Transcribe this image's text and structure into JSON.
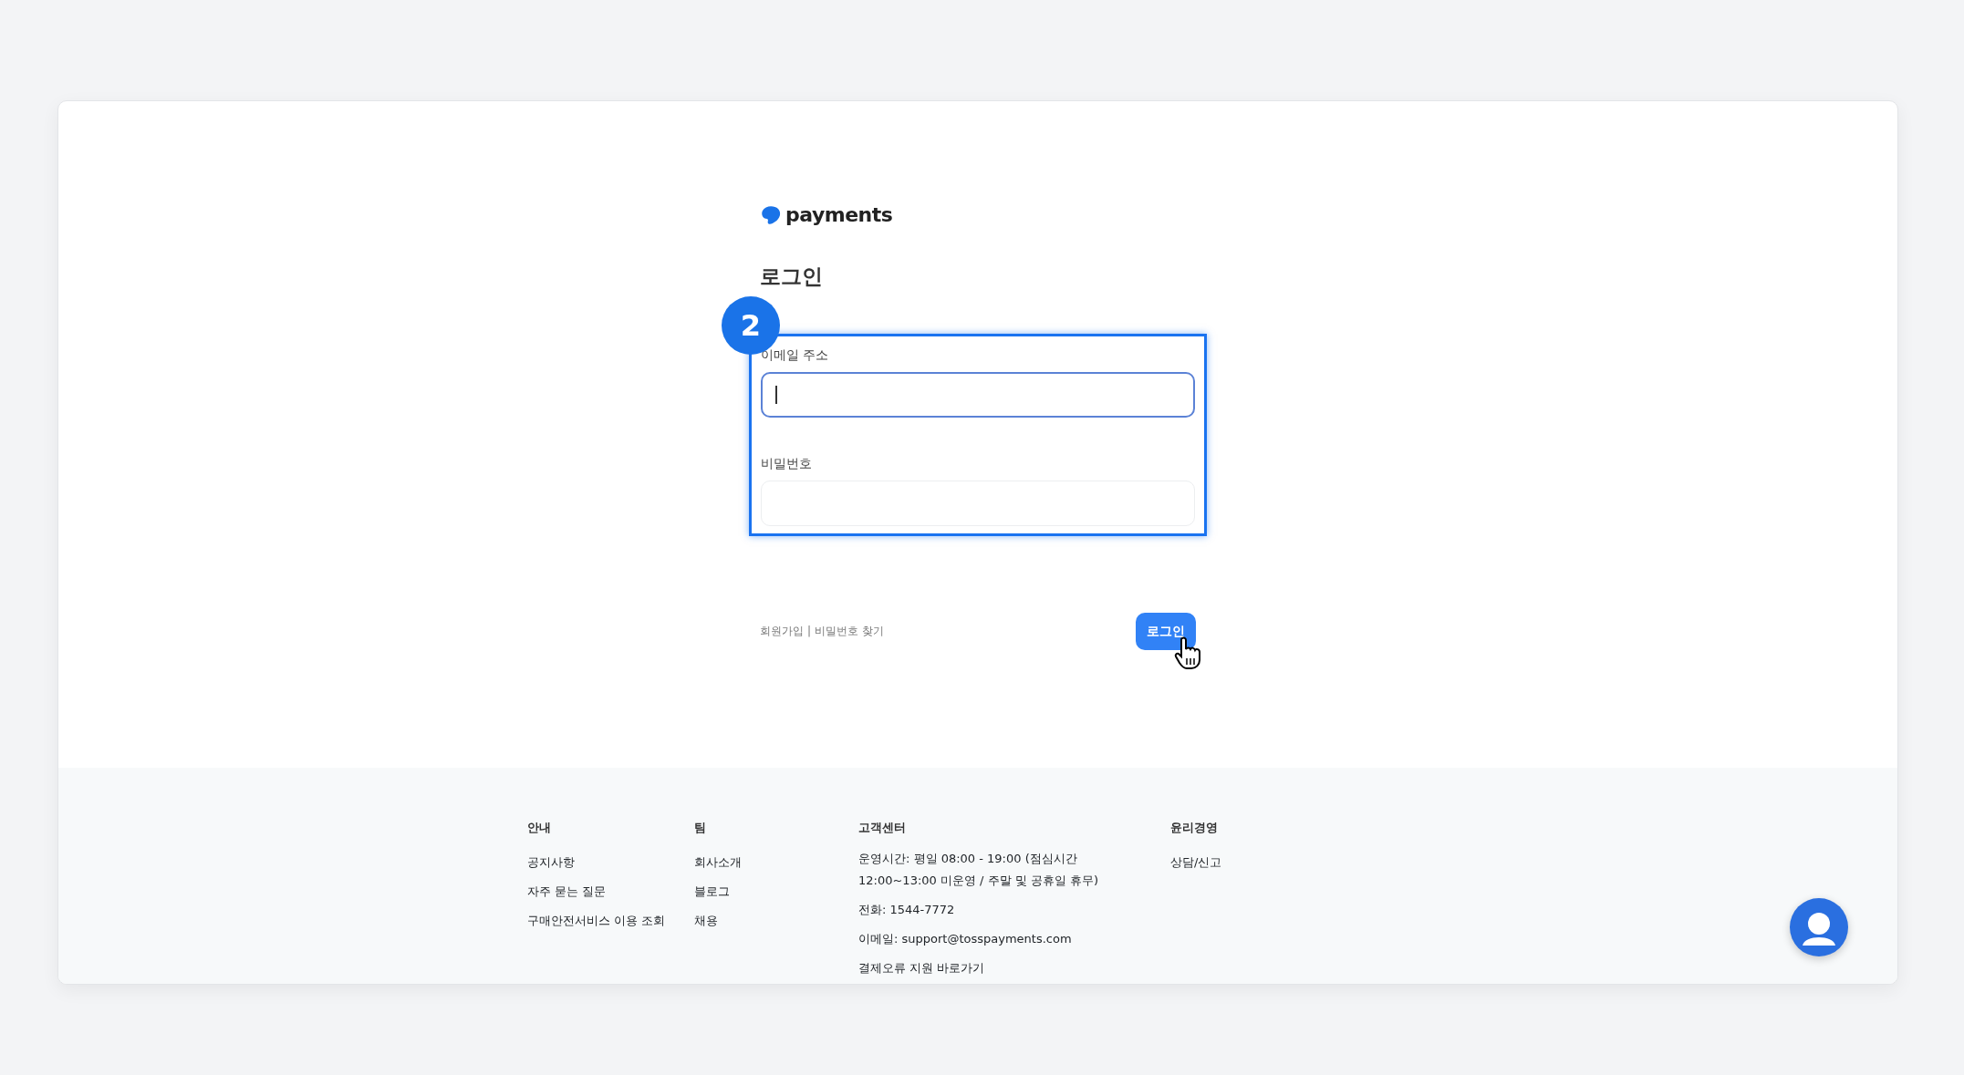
{
  "logo": {
    "text": "payments"
  },
  "heading": "로그인",
  "annotation": {
    "number": "2"
  },
  "fields": [
    {
      "label": "이메일 주소",
      "focused": true
    },
    {
      "label": "비밀번호",
      "focused": false
    }
  ],
  "links": [
    "회원가입",
    "비밀번호 찾기"
  ],
  "link_separator": "|",
  "login_button": "로그인",
  "footer": [
    {
      "title": "안내",
      "items": [
        "공지사항",
        "자주 묻는 질문",
        "구매안전서비스 이용 조회"
      ]
    },
    {
      "title": "팀",
      "items": [
        "회사소개",
        "블로그",
        "채용"
      ]
    },
    {
      "title": "고객센터",
      "items": [
        "운영시간: 평일 08:00 - 19:00 (점심시간 12:00~13:00 미운영 / 주말 및 공휴일 휴무)",
        "전화: 1544-7772",
        "이메일: support@tosspayments.com",
        "결제오류 지원 바로가기"
      ]
    },
    {
      "title": "윤리경영",
      "items": [
        "상담/신고"
      ]
    }
  ]
}
